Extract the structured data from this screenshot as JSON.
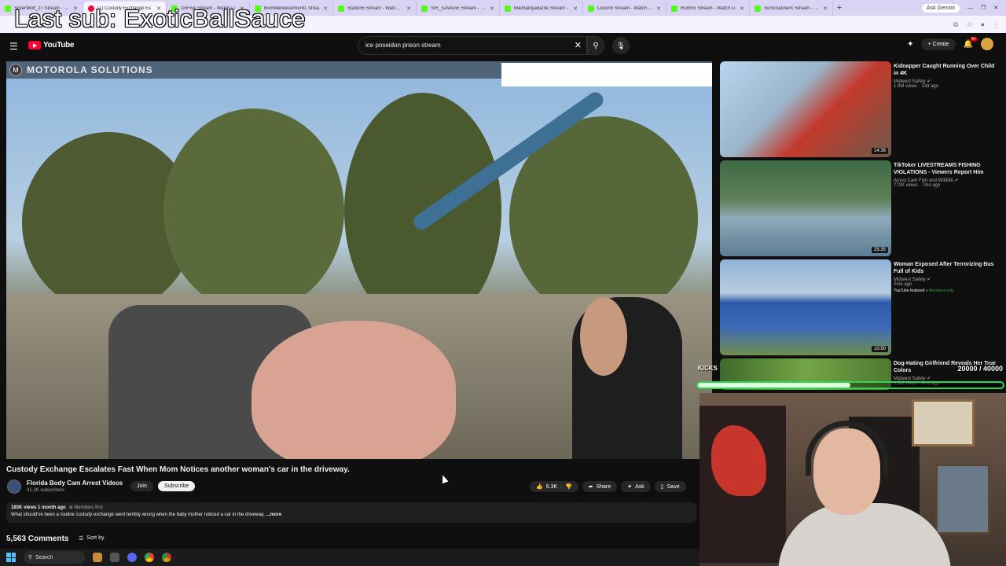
{
  "browser": {
    "tabs": [
      {
        "label": "SilverWolf_27 Stream - Wa",
        "active": false
      },
      {
        "label": "(1) Custody Exchange Es",
        "active": true
      },
      {
        "label": "OnFive Stream - Watch Li",
        "active": false
      },
      {
        "label": "Bumblebeefarmer81 Strea",
        "active": false
      },
      {
        "label": "Station5 Stream - Watch Li",
        "active": false
      },
      {
        "label": "SIR_SAVAGE Stream - Watc",
        "active": false
      },
      {
        "label": "Maintainyadame Stream -",
        "active": false
      },
      {
        "label": "Looonn Stream - Watch Liv",
        "active": false
      },
      {
        "label": "Ruhhnr Stream - Watch Li",
        "active": false
      },
      {
        "label": "Sonic3asherX Stream - Wa",
        "active": false
      }
    ],
    "ask_gemini": "Ask Gemini"
  },
  "overlay": {
    "last_sub": "Last sub: ExoticBallSauce",
    "goal_label": "KICKS",
    "goal_text": "20000 / 40000",
    "goal_progress": 0.5
  },
  "youtube": {
    "logo_text": "YouTube",
    "search_query": "ice poseidon prison stream",
    "create_label": "Create",
    "notif_count": "9+"
  },
  "player": {
    "brand": "MOTOROLA SOLUTIONS"
  },
  "video": {
    "title": "Custody Exchange Escalates Fast When Mom Notices another woman's car in the driveway.",
    "channel": "Florida Body Cam Arrest Videos",
    "subscribers": "31.2K subscribers",
    "join": "Join",
    "subscribe": "Subscribe",
    "likes": "6.3K",
    "share": "Share",
    "ask": "Ask",
    "save": "Save",
    "meta": "183K views  1 month ago",
    "members_first": "Members first",
    "description": "What should've been a routine custody exchange went terribly wrong when the baby mother noticed a car in the driveway.",
    "more": "...more",
    "comments": "5,563 Comments",
    "sort_by": "Sort by"
  },
  "recommendations": [
    {
      "title": "Kidnapper Caught Running Over Child in 4K",
      "channel": "Midwest Safety",
      "views": "1.9M views · 13d ago",
      "duration": "14:36"
    },
    {
      "title": "TikToker LIVESTREAMS FISHING VIOLATIONS - Viewers Report Him",
      "channel": "Arrest Cam Fish and Wildlife",
      "views": "772K views · 7mo ago",
      "duration": "25:35"
    },
    {
      "title": "Woman Exposed After Terrorizing Bus Full of Kids",
      "channel": "Midwest Safety",
      "views": "2mo ago",
      "featured": "YouTube featured",
      "members": "Members only",
      "duration": "10:50"
    },
    {
      "title": "Dog-Hating Girlfriend Reveals Her True Colors",
      "channel": "Midwest Safety",
      "views": "1.5M views · 4mo ago",
      "duration": ""
    }
  ],
  "taskbar": {
    "search": "Search"
  },
  "colors": {
    "yt_red": "#ff0033",
    "kick_green": "#53fc18",
    "goal_border": "#2cd94a"
  }
}
